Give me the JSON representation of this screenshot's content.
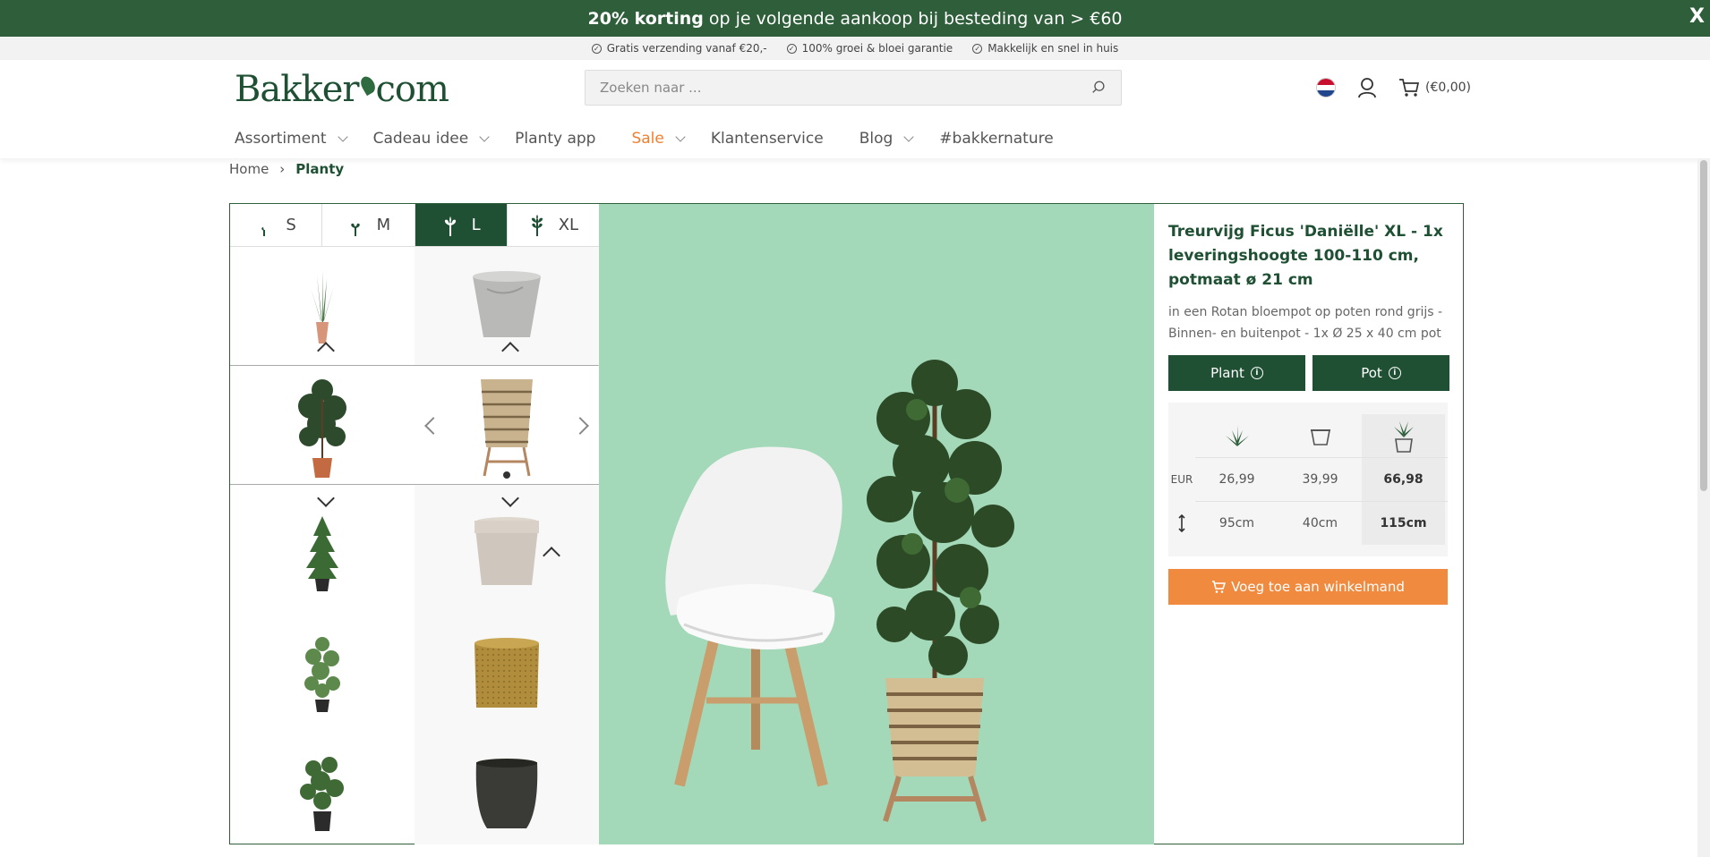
{
  "promo": {
    "bold": "20% korting",
    "rest": " op je volgende aankoop bij besteding van > €60",
    "close": "X"
  },
  "usp": [
    "Gratis verzending vanaf €20,-",
    "100% groei & bloei garantie",
    "Makkelijk en snel in huis"
  ],
  "logo": {
    "part1": "Bakker",
    "part2": "com"
  },
  "search": {
    "placeholder": "Zoeken naar ..."
  },
  "cart": {
    "label": "(€0,00)"
  },
  "nav": [
    "Assortiment",
    "Cadeau idee",
    "Planty app",
    "Sale",
    "Klantenservice",
    "Blog",
    "#bakkernature"
  ],
  "breadcrumb": {
    "home": "Home",
    "current": "Planty"
  },
  "sizes": [
    "S",
    "M",
    "L",
    "XL"
  ],
  "product": {
    "title": "Treurvijg Ficus 'Daniëlle' XL - 1x leveringshoogte 100-110 cm, potmaat ø 21 cm",
    "description": "in een Rotan bloempot op poten rond grijs - Binnen- en buitenpot - 1x Ø 25 x 40 cm pot",
    "plant_button": "Plant",
    "pot_button": "Pot"
  },
  "price_table": {
    "currency": "EUR",
    "prices": [
      "26,99",
      "39,99",
      "66,98"
    ],
    "heights": [
      "95cm",
      "40cm",
      "115cm"
    ]
  },
  "add_to_cart": "Voeg toe aan winkelmand",
  "colors": {
    "brand_green": "#1f5034",
    "promo_green": "#2e5e3a",
    "accent_orange": "#f08a3e",
    "hero_bg": "#a3d9b8"
  }
}
